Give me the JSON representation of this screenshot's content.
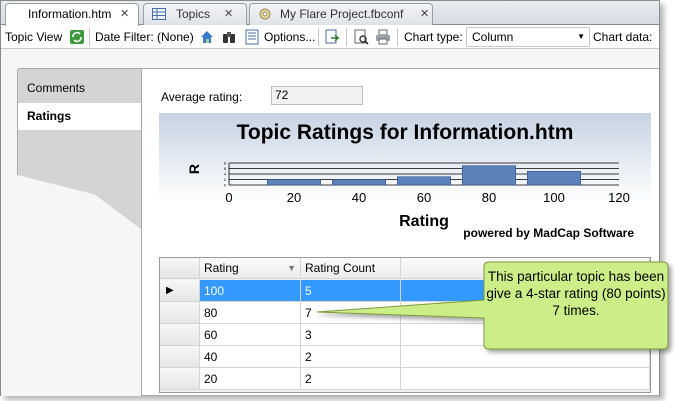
{
  "tabs": [
    {
      "label": "Information.htm",
      "close": "✕"
    },
    {
      "label": "Topics",
      "close": "✕"
    },
    {
      "label": "My Flare Project.fbconf",
      "close": "✕"
    }
  ],
  "toolbar": {
    "topic_view": "Topic View",
    "date_filter": "Date Filter: (None)",
    "options": "Options...",
    "chart_type_label": "Chart type:",
    "chart_type_value": "Column",
    "chart_data_label": "Chart data:"
  },
  "left_tabs": {
    "comments": "Comments",
    "ratings": "Ratings"
  },
  "average": {
    "label": "Average rating:",
    "value": "72"
  },
  "chart_data": {
    "type": "bar",
    "title": "Topic Ratings for Information.htm",
    "xlabel": "Rating",
    "ylabel": "R",
    "categories": [
      20,
      40,
      60,
      80,
      100
    ],
    "values": [
      2,
      2,
      3,
      7,
      5
    ],
    "xlim": [
      0,
      120
    ],
    "ylim": [
      0,
      8
    ],
    "xticks": [
      "0",
      "20",
      "40",
      "60",
      "80",
      "100",
      "120"
    ],
    "yticks": [
      "0",
      "2",
      "4",
      "6",
      "8"
    ],
    "bar_color": "#5b82bb",
    "footer": "powered by MadCap Software"
  },
  "grid": {
    "headers": [
      "Rating",
      "Rating Count"
    ],
    "rows": [
      {
        "rating": "100",
        "count": "5"
      },
      {
        "rating": "80",
        "count": "7"
      },
      {
        "rating": "60",
        "count": "3"
      },
      {
        "rating": "40",
        "count": "2"
      },
      {
        "rating": "20",
        "count": "2"
      }
    ],
    "selected_row_color": "#3399ff"
  },
  "callout": {
    "text": "This particular topic has been give a 4-star rating (80 points) 7 times.",
    "fill": "#ccee88"
  }
}
